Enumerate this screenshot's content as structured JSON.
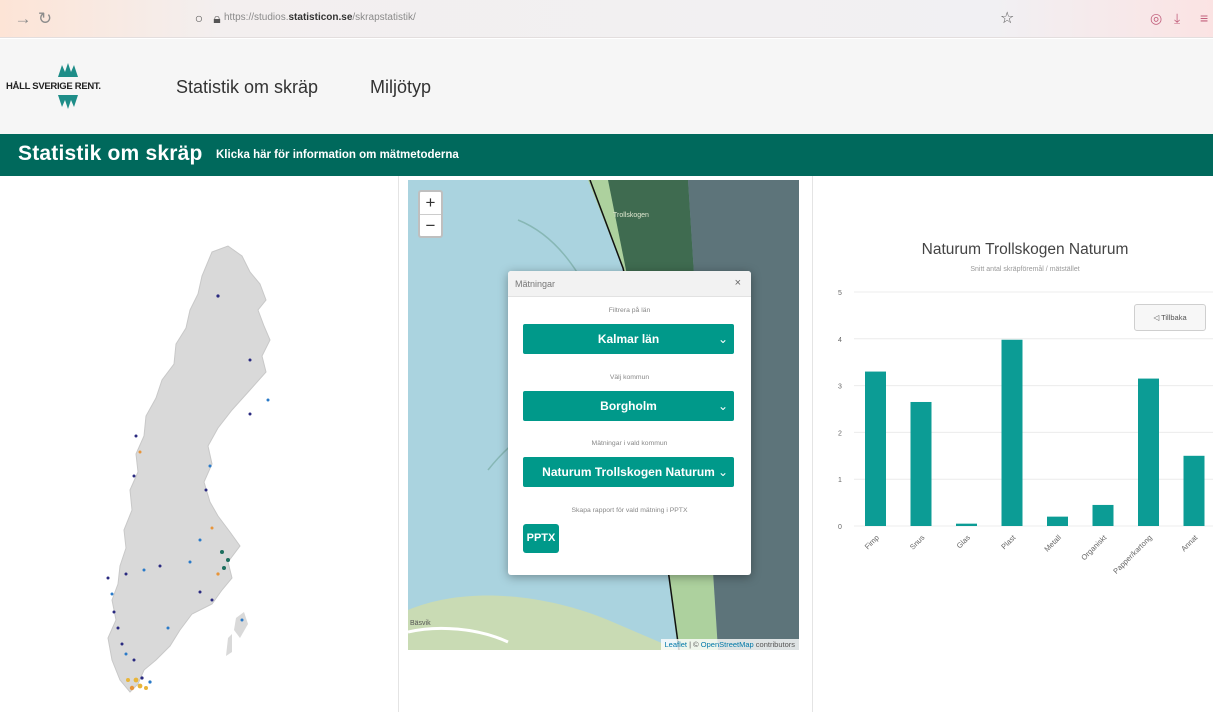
{
  "browser": {
    "url_prefix": "https://studios.",
    "url_domain": "statisticon.se",
    "url_path": "/skrapstatistik/"
  },
  "header": {
    "logo_text": "HÅLL SVERIGE RENT.",
    "nav": [
      "Statistik om skräp",
      "Miljötyp"
    ]
  },
  "banner": {
    "title": "Statistik om skräp",
    "info_link": "Klicka här för information om mätmetoderna"
  },
  "map": {
    "zoom_in": "+",
    "zoom_out": "−",
    "place_label": "Trollskogen",
    "corner_label": "Bäsvik",
    "attribution_leaflet": "Leaflet",
    "attribution_sep": " | © ",
    "attribution_osm": "OpenStreetMap",
    "attribution_tail": " contributors"
  },
  "dialog": {
    "title": "Mätningar",
    "close": "×",
    "lan_label": "Filtrera på län",
    "lan_value": "Kalmar län",
    "kommun_label": "Välj kommun",
    "kommun_value": "Borgholm",
    "matning_label": "Mätningar i vald kommun",
    "matning_value": "Naturum Trollskogen Naturum",
    "report_label": "Skapa rapport för vald mätning i PPTX",
    "pptx_button": "PPTX"
  },
  "chart": {
    "back_label": "◁ Tillbaka"
  },
  "chart_data": {
    "type": "bar",
    "title": "Naturum Trollskogen Naturum",
    "subtitle": "Snitt antal skräpföremål / mätstället",
    "categories": [
      "Fimp",
      "Snus",
      "Glas",
      "Plast",
      "Metall",
      "Organiskt",
      "Papper/kartong",
      "Annat"
    ],
    "values": [
      3.3,
      2.65,
      0.05,
      3.98,
      0.2,
      0.45,
      3.15,
      1.5
    ],
    "ylim": [
      0,
      5
    ],
    "yticks": [
      0,
      1,
      2,
      3,
      4,
      5
    ],
    "bar_color": "#0c9c95",
    "grid": true
  }
}
